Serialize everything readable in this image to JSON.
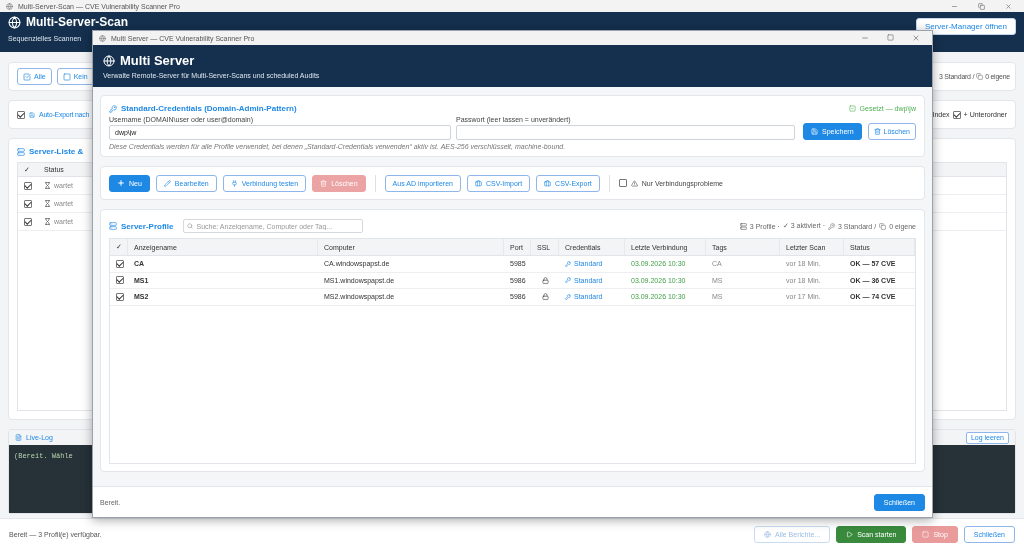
{
  "app": {
    "window_title": "Multi-Server-Scan — CVE Vulnerability Scanner Pro",
    "header": {
      "title": "Multi-Server-Scan",
      "subtitle": "Sequenzielles Scannen",
      "buttons": [
        {
          "label": "Server-Manager öffnen"
        }
      ]
    },
    "selection_bar": {
      "buttons": [
        {
          "label": "Alle",
          "checked": true
        },
        {
          "label": "Kein",
          "checked": false
        }
      ],
      "summary": [
        "3 Standard /",
        "0 eigene"
      ]
    },
    "options_bar": {
      "auto_export": {
        "label": "Auto-Export nach",
        "checked": true
      },
      "index_label": "Index",
      "subfolders": {
        "label": "+ Unterordner",
        "checked": true
      }
    },
    "server_list": {
      "title": "Server-Liste &",
      "columns": [
        "✓",
        "Status"
      ],
      "rows": [
        {
          "checked": true,
          "status": "wartet"
        },
        {
          "checked": true,
          "status": "wartet"
        },
        {
          "checked": true,
          "status": "wartet"
        }
      ]
    },
    "live_log": {
      "title": "Live-Log",
      "clear_button": "Log leeren",
      "text": "(Bereit. Wähle"
    },
    "status_bar": {
      "text": "Bereit — 3 Profil(e) verfügbar.",
      "buttons": [
        {
          "label": "Alle Berichte...",
          "kind": "reports",
          "disabled": true
        },
        {
          "label": "Scan starten",
          "kind": "start",
          "disabled": false
        },
        {
          "label": "Stop",
          "kind": "stop",
          "disabled": true
        },
        {
          "label": "Schließen",
          "kind": "close",
          "disabled": false
        }
      ]
    }
  },
  "dialog": {
    "window_title": "Multi Server — CVE Vulnerability Scanner Pro",
    "header": {
      "title": "Multi Server",
      "subtitle": "Verwalte Remote-Server für Multi-Server-Scans und scheduled Audits"
    },
    "credentials": {
      "title": "Standard-Credentials (Domain-Admin-Pattern)",
      "state": "Gesetzt — dwp\\jw",
      "username_label": "Username (DOMAIN\\user oder user@domain)",
      "username": "dwp\\jw",
      "password_label": "Passwort (leer lassen = unverändert)",
      "save_button": "Speichern",
      "delete_button": "Löschen",
      "note": "Diese Credentials werden für alle Profile verwendet, bei denen „Standard-Credentials verwenden“ aktiv ist. AES-256 verschlüsselt, machine-bound."
    },
    "toolbar": {
      "groups": [
        [
          {
            "label": "Neu",
            "kind": "new",
            "disabled": false
          },
          {
            "label": "Bearbeiten",
            "kind": "edit",
            "disabled": false
          },
          {
            "label": "Verbindung testen",
            "kind": "test",
            "disabled": false
          },
          {
            "label": "Löschen",
            "kind": "delete",
            "disabled": true
          }
        ],
        [
          {
            "label": "Aus AD importieren",
            "kind": "ad",
            "disabled": false
          },
          {
            "label": "CSV-Import",
            "kind": "csv",
            "disabled": false
          },
          {
            "label": "CSV-Export",
            "kind": "csv",
            "disabled": false
          }
        ]
      ],
      "filter": {
        "label": "Nur Verbindungsprobleme",
        "checked": false
      }
    },
    "profiles": {
      "title": "Server-Profile",
      "search_placeholder": "Suche: Anzeigename, Computer oder Tag...",
      "stats": [
        "3 Profile ·",
        "✓ 3 aktiviert ·",
        "3 Standard /",
        "0 eigene"
      ],
      "columns": [
        "✓",
        "Anzeigename",
        "Computer",
        "Port",
        "SSL",
        "Credentials",
        "Letzte Verbindung",
        "Tags",
        "Letzter Scan",
        "Status"
      ],
      "rows": [
        {
          "checked": true,
          "name": "CA",
          "computer": "CA.windowspapst.de",
          "port": "5985",
          "ssl": false,
          "credentials": "Standard",
          "last_connection": "03.09.2026 10:30",
          "tags": "CA",
          "last_scan": "vor 18 Min.",
          "status": "OK — 57 CVE"
        },
        {
          "checked": true,
          "name": "MS1",
          "computer": "MS1.windowspapst.de",
          "port": "5986",
          "ssl": true,
          "credentials": "Standard",
          "last_connection": "03.09.2026 10:30",
          "tags": "MS",
          "last_scan": "vor 18 Min.",
          "status": "OK — 36 CVE"
        },
        {
          "checked": true,
          "name": "MS2",
          "computer": "MS2.windowspapst.de",
          "port": "5986",
          "ssl": true,
          "credentials": "Standard",
          "last_connection": "03.09.2026 10:30",
          "tags": "MS",
          "last_scan": "vor 17 Min.",
          "status": "OK — 74 CVE"
        }
      ]
    },
    "footer": {
      "status": "Bereit.",
      "close_button": "Schließen"
    }
  }
}
